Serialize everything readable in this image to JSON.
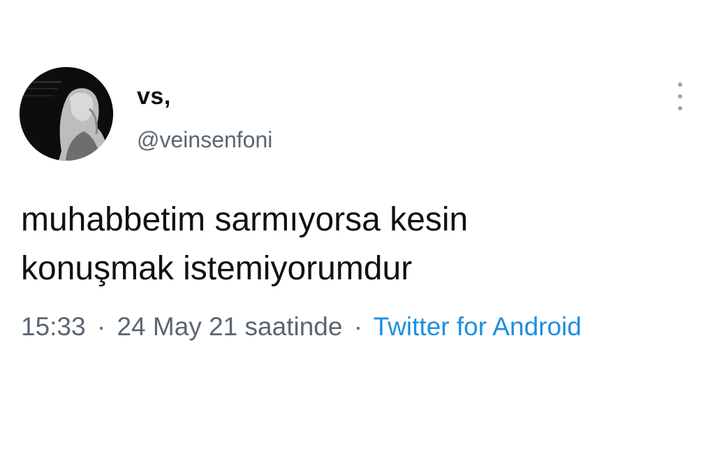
{
  "tweet": {
    "author": {
      "display_name": "vs,",
      "handle": "@veinsenfoni",
      "avatar_icon": "profile-photo"
    },
    "menu_icon": "more-vertical-icon",
    "text_line_1": "muhabbetim sarmıyorsa kesin",
    "text_line_2": "konuşmak istemiyorumdur",
    "time": "15:33",
    "separator": "·",
    "date": "24 May 21 saatinde",
    "source": "Twitter for Android"
  },
  "colors": {
    "text": "#111111",
    "secondary": "#5b6670",
    "link": "#1d8fe0",
    "background": "#ffffff"
  }
}
